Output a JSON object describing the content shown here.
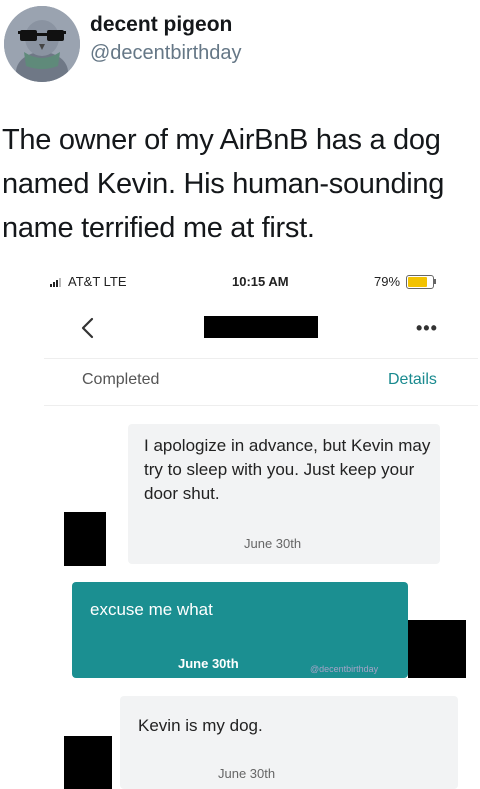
{
  "tweet": {
    "display_name": "decent pigeon",
    "handle": "@decentbirthday",
    "text": "The owner of my AirBnB has a dog named Kevin. His human-sounding name terrified me at first."
  },
  "phone": {
    "status_bar": {
      "carrier": "AT&T  LTE",
      "time": "10:15 AM",
      "battery": "79%",
      "battery_level": 0.79,
      "battery_color": "#f2c200"
    },
    "nav": {
      "back_icon": "chevron-left-icon",
      "more_icon": "more-dots-icon",
      "more_label": "•••"
    },
    "status_row": {
      "status": "Completed",
      "details_link": "Details",
      "accent_color": "#1a8a8f"
    },
    "messages": [
      {
        "side": "incoming",
        "text": "I apologize in advance, but Kevin may try to sleep with you. Just keep your door shut.",
        "date": "June 30th"
      },
      {
        "side": "outgoing",
        "text": "excuse me what",
        "date": "June 30th",
        "bubble_color": "#1b8f91"
      },
      {
        "side": "incoming",
        "text": "Kevin is my dog.",
        "date": "June 30th"
      }
    ],
    "watermark": "@decentbirthday"
  }
}
